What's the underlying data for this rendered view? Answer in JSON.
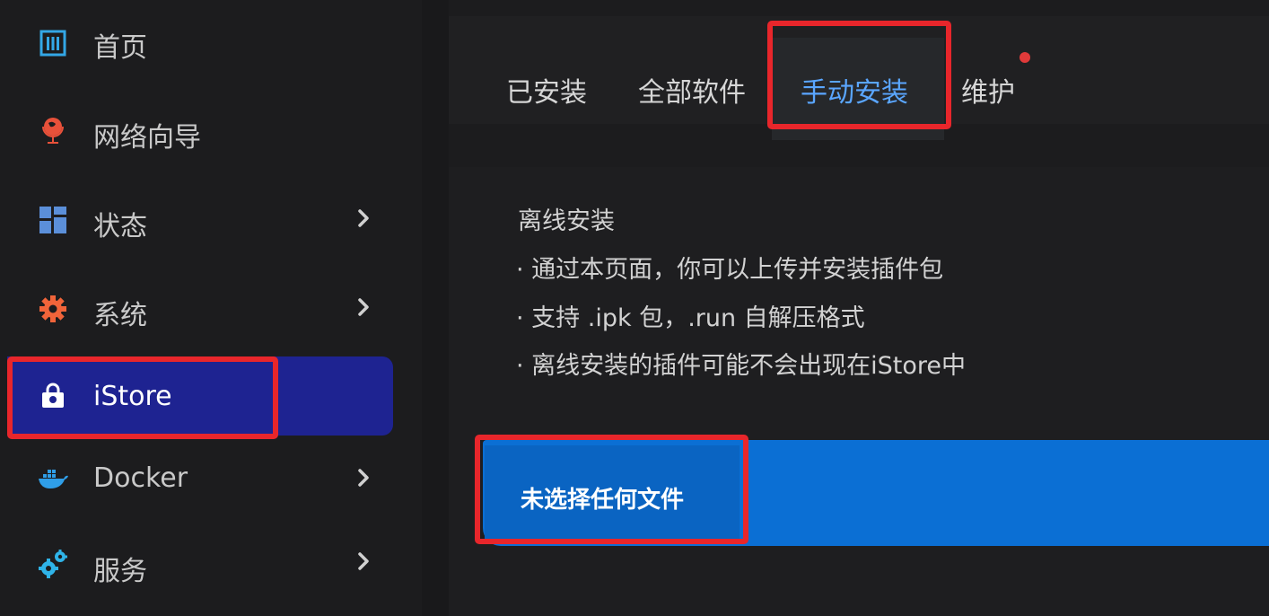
{
  "sidebar": {
    "items": [
      {
        "label": "首页",
        "icon": "dashboard-icon",
        "has_submenu": false
      },
      {
        "label": "网络向导",
        "icon": "globe-icon",
        "has_submenu": false
      },
      {
        "label": "状态",
        "icon": "grid-icon",
        "has_submenu": true
      },
      {
        "label": "系统",
        "icon": "gear-icon",
        "has_submenu": true
      },
      {
        "label": "iStore",
        "icon": "shopping-bag-icon",
        "has_submenu": false,
        "active": true
      },
      {
        "label": "Docker",
        "icon": "docker-whale-icon",
        "has_submenu": true
      },
      {
        "label": "服务",
        "icon": "gears-icon",
        "has_submenu": true
      }
    ]
  },
  "tabs": [
    {
      "label": "已安装"
    },
    {
      "label": "全部软件"
    },
    {
      "label": "手动安装",
      "active": true
    },
    {
      "label": "维护",
      "notification": true
    }
  ],
  "info": {
    "title": "离线安装",
    "lines": [
      "· 通过本页面，你可以上传并安装插件包",
      "· 支持 .ipk 包，.run 自解压格式",
      "· 离线安装的插件可能不会出现在iStore中"
    ]
  },
  "upload": {
    "label": "未选择任何文件"
  },
  "colors": {
    "background": "#1c1c1e",
    "active_nav": "#1e2391",
    "active_tab_text": "#5aa6ff",
    "upload_bar": "#0b6fd4",
    "highlight": "#e8262b",
    "notification_dot": "#e03a3a"
  }
}
